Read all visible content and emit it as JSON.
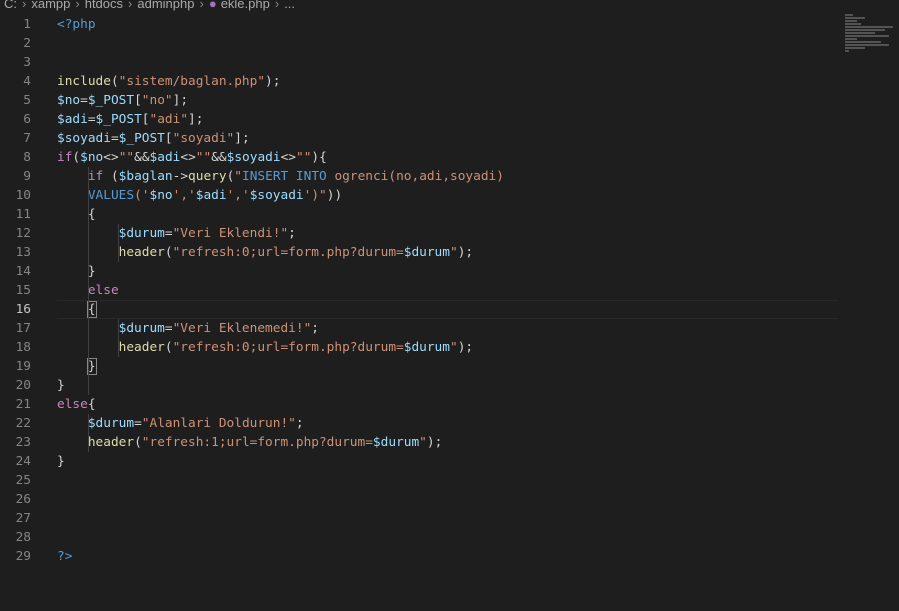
{
  "breadcrumb": [
    "C:",
    "xampp",
    "htdocs",
    "adminphp",
    "ekle.php",
    "..."
  ],
  "editor": {
    "current_line": 16,
    "lines": [
      [
        [
          "tag",
          "<?php"
        ]
      ],
      [],
      [],
      [
        [
          "fn",
          "include"
        ],
        [
          "op",
          "("
        ],
        [
          "str",
          "\"sistem/baglan.php\""
        ],
        [
          "op",
          ");"
        ]
      ],
      [
        [
          "var",
          "$no"
        ],
        [
          "op",
          "="
        ],
        [
          "var",
          "$_POST"
        ],
        [
          "op",
          "["
        ],
        [
          "str",
          "\"no\""
        ],
        [
          "op",
          "];"
        ]
      ],
      [
        [
          "var",
          "$adi"
        ],
        [
          "op",
          "="
        ],
        [
          "var",
          "$_POST"
        ],
        [
          "op",
          "["
        ],
        [
          "str",
          "\"adi\""
        ],
        [
          "op",
          "];"
        ]
      ],
      [
        [
          "var",
          "$soyadi"
        ],
        [
          "op",
          "="
        ],
        [
          "var",
          "$_POST"
        ],
        [
          "op",
          "["
        ],
        [
          "str",
          "\"soyadi\""
        ],
        [
          "op",
          "];"
        ]
      ],
      [
        [
          "kw",
          "if"
        ],
        [
          "op",
          "("
        ],
        [
          "var",
          "$no"
        ],
        [
          "op",
          "<>"
        ],
        [
          "str",
          "\"\""
        ],
        [
          "op",
          "&&"
        ],
        [
          "var",
          "$adi"
        ],
        [
          "op",
          "<>"
        ],
        [
          "str",
          "\"\""
        ],
        [
          "op",
          "&&"
        ],
        [
          "var",
          "$soyadi"
        ],
        [
          "op",
          "<>"
        ],
        [
          "str",
          "\"\""
        ],
        [
          "op",
          "){"
        ]
      ],
      [
        [
          "op",
          "    "
        ],
        [
          "kw",
          "if"
        ],
        [
          "op",
          " ("
        ],
        [
          "var",
          "$baglan"
        ],
        [
          "op",
          "->"
        ],
        [
          "fn",
          "query"
        ],
        [
          "op",
          "("
        ],
        [
          "str",
          "\""
        ],
        [
          "sql",
          "INSERT INTO"
        ],
        [
          "str",
          " ogrenci(no,adi,soyadi)"
        ]
      ],
      [
        [
          "op",
          "    "
        ],
        [
          "sql",
          "VALUES"
        ],
        [
          "str",
          "('"
        ],
        [
          "var",
          "$no"
        ],
        [
          "str",
          "','"
        ],
        [
          "var",
          "$adi"
        ],
        [
          "str",
          "','"
        ],
        [
          "var",
          "$soyadi"
        ],
        [
          "str",
          "')\""
        ],
        [
          "op",
          "))"
        ]
      ],
      [
        [
          "op",
          "    {"
        ]
      ],
      [
        [
          "op",
          "        "
        ],
        [
          "var",
          "$durum"
        ],
        [
          "op",
          "="
        ],
        [
          "str",
          "\"Veri Eklendi!\""
        ],
        [
          "op",
          ";"
        ]
      ],
      [
        [
          "op",
          "        "
        ],
        [
          "fn",
          "header"
        ],
        [
          "op",
          "("
        ],
        [
          "str",
          "\"refresh:0;url=form.php?durum="
        ],
        [
          "var",
          "$durum"
        ],
        [
          "str",
          "\""
        ],
        [
          "op",
          ");"
        ]
      ],
      [
        [
          "op",
          "    }"
        ]
      ],
      [
        [
          "op",
          "    "
        ],
        [
          "kw",
          "else"
        ]
      ],
      [
        [
          "op",
          "    "
        ],
        [
          "bm",
          "{"
        ]
      ],
      [
        [
          "op",
          "        "
        ],
        [
          "var",
          "$durum"
        ],
        [
          "op",
          "="
        ],
        [
          "str",
          "\"Veri Eklenemedi!\""
        ],
        [
          "op",
          ";"
        ]
      ],
      [
        [
          "op",
          "        "
        ],
        [
          "fn",
          "header"
        ],
        [
          "op",
          "("
        ],
        [
          "str",
          "\"refresh:0;url=form.php?durum="
        ],
        [
          "var",
          "$durum"
        ],
        [
          "str",
          "\""
        ],
        [
          "op",
          ");"
        ]
      ],
      [
        [
          "op",
          "    "
        ],
        [
          "bm",
          "}"
        ]
      ],
      [
        [
          "op",
          "}"
        ]
      ],
      [
        [
          "kw",
          "else"
        ],
        [
          "op",
          "{"
        ]
      ],
      [
        [
          "op",
          "    "
        ],
        [
          "var",
          "$durum"
        ],
        [
          "op",
          "="
        ],
        [
          "str",
          "\"Alanlari Doldurun!\""
        ],
        [
          "op",
          ";"
        ]
      ],
      [
        [
          "op",
          "    "
        ],
        [
          "fn",
          "header"
        ],
        [
          "op",
          "("
        ],
        [
          "str",
          "\"refresh:1;url=form.php?durum="
        ],
        [
          "var",
          "$durum"
        ],
        [
          "str",
          "\""
        ],
        [
          "op",
          ");"
        ]
      ],
      [
        [
          "op",
          "}"
        ]
      ],
      [],
      [],
      [],
      [],
      [
        [
          "tag",
          "?>"
        ]
      ]
    ]
  }
}
